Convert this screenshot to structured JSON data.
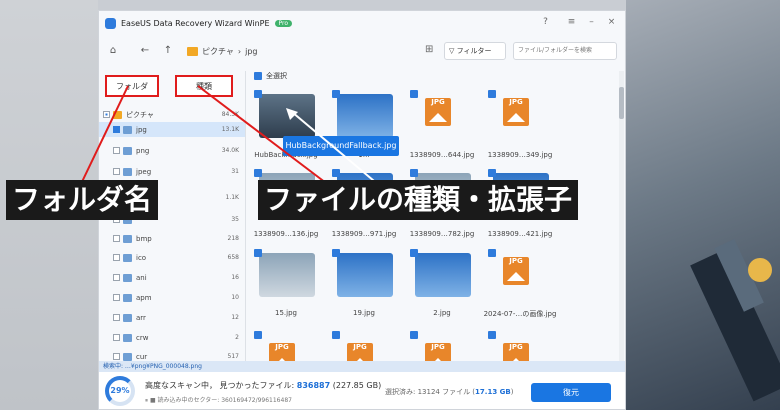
{
  "window": {
    "title": "EaseUS Data Recovery Wizard WinPE",
    "badge": "Pro"
  },
  "toolbar": {
    "crumb_root": "ピクチャ",
    "crumb_sep": "›",
    "crumb_leaf": "jpg",
    "filter_label": "フィルター",
    "search_placeholder": "ファイル/フォルダーを検索"
  },
  "tabs": {
    "folder": "フォルダ",
    "type": "種類"
  },
  "tree": [
    {
      "label": "ピクチャ",
      "count": "84.3K"
    },
    {
      "label": "jpg",
      "count": "13.1K"
    },
    {
      "label": "png",
      "count": "34.0K"
    },
    {
      "label": "jpeg",
      "count": "31"
    },
    {
      "label": "",
      "count": "1.1K"
    },
    {
      "label": "",
      "count": "35"
    },
    {
      "label": "bmp",
      "count": "218"
    },
    {
      "label": "ico",
      "count": "658"
    },
    {
      "label": "ani",
      "count": "16"
    },
    {
      "label": "apm",
      "count": "10"
    },
    {
      "label": "arr",
      "count": "12"
    },
    {
      "label": "crw",
      "count": "2"
    },
    {
      "label": "cur",
      "count": "517"
    }
  ],
  "grid": {
    "select_all": "全選択",
    "captions_r1": [
      "HubBack…ack.jpg",
      "1…",
      "1338909…644.jpg",
      "1338909…349.jpg"
    ],
    "captions_r2": [
      "1338909…136.jpg",
      "1338909…971.jpg",
      "1338909…782.jpg",
      "1338909…421.jpg"
    ],
    "captions_r3": [
      "15.jpg",
      "19.jpg",
      "2.jpg",
      "2024-07-…の画像.jpg"
    ],
    "jpg_label": "JPG"
  },
  "tooltip": "HubBackgroundFallback.jpg",
  "status_path": "検索中: …¥png¥PNG_000048.png",
  "bottom": {
    "progress": "29%",
    "scan_text": "高度なスキャン中，  見つかったファイル: ",
    "found_count": "836887",
    "found_size": " (227.85 GB)",
    "sector": "読み込み中のセクター: 360169472/996116487",
    "selected_prefix": "選択済み: 13124 ファイル (",
    "selected_size": "17.13 GB",
    "selected_suffix": ")",
    "recover_label": "復元"
  },
  "annotations": {
    "folder_name": "フォルダ名",
    "file_type": "ファイルの種類・拡張子"
  }
}
